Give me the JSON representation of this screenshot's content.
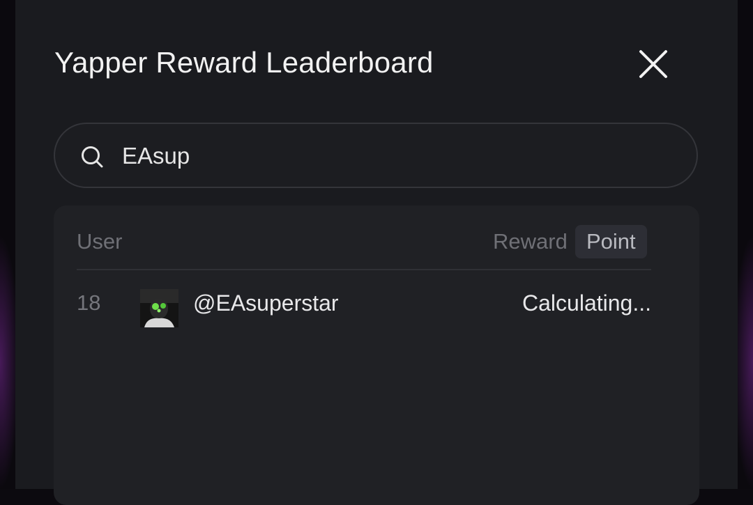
{
  "modal": {
    "title": "Yapper Reward Leaderboard",
    "close_icon": "close-icon"
  },
  "search": {
    "icon": "search-icon",
    "value": "EAsup",
    "placeholder": ""
  },
  "table": {
    "columns": {
      "user": "User",
      "reward": "Reward",
      "point": "Point"
    },
    "active_column": "point",
    "rows": [
      {
        "rank": "18",
        "handle": "@EAsuperstar",
        "value": "Calculating...",
        "avatar_icon": "user-avatar"
      }
    ]
  },
  "colors": {
    "modal_bg": "#1a1b1f",
    "card_bg": "#202125",
    "text_primary": "#f2f2f2",
    "text_muted": "#6f7076",
    "active_tab_bg": "#2d2e35"
  }
}
